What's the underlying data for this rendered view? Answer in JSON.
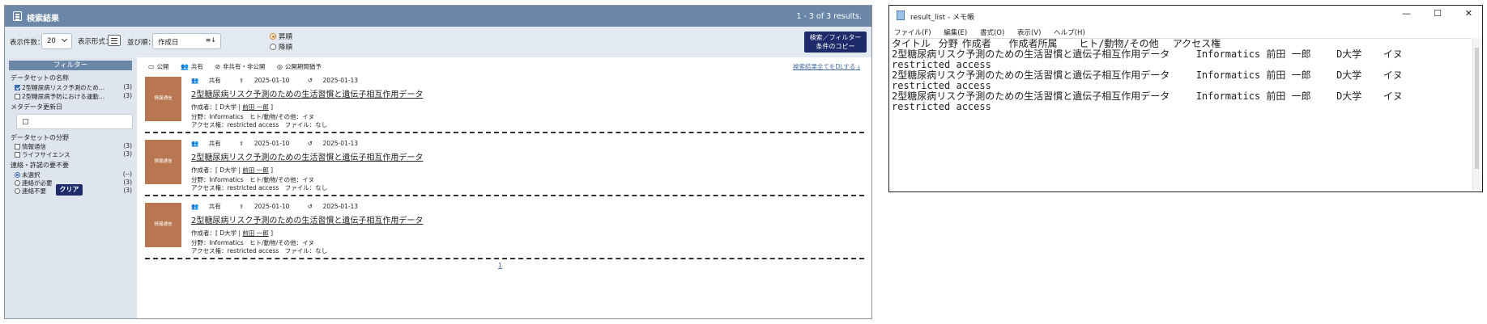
{
  "app": {
    "title": "検索結果",
    "result_count": "1 - 3 of 3 results.",
    "toolbar": {
      "per_page_label": "表示件数：",
      "per_page_value": "20",
      "display_mode_label": "表示形式：",
      "sort_label": "並び順：",
      "sort_value": "作成日",
      "asc_label": "昇順",
      "desc_label": "降順",
      "copy_button_line1": "検索／フィルター",
      "copy_button_line2": "条件のコピー"
    },
    "sidebar": {
      "filter_title": "フィルター",
      "dataset_name_label": "データセットの名称",
      "dataset_options": [
        {
          "label": "2型糖尿病リスク予測のため…",
          "count": "(3)",
          "checked": true
        },
        {
          "label": "2型糖尿病予防における運動…",
          "count": "(3)",
          "checked": false
        }
      ],
      "metadata_updated_label": "メタデータ更新日",
      "field_label": "データセットの分野",
      "field_options": [
        {
          "label": "情報通信",
          "count": "(3)"
        },
        {
          "label": "ライフサイエンス",
          "count": "(3)"
        }
      ],
      "contact_label": "連絡・許諾の要不要",
      "contact_options": [
        {
          "label": "未選択",
          "count": "(--)",
          "selected": true
        },
        {
          "label": "連絡が必要",
          "count": "(3)",
          "selected": false
        },
        {
          "label": "連絡不要",
          "count": "(3)",
          "selected": false
        }
      ],
      "clear_button": "クリア"
    },
    "tabs": [
      "公開",
      "共有",
      "非共有・非公開",
      "公開期間猶予"
    ],
    "download_link": "検索結果全てをDLする",
    "results": [
      {
        "thumb": "情報通信",
        "share": "共有",
        "created": "2025-01-10",
        "updated": "2025-01-13",
        "title": "2型糖尿病リスク予測のための生活習慣と遺伝子相互作用データ",
        "author_prefix": "作成者：[ D大学 | ",
        "author_name": "前田 一郎",
        "author_suffix": " ]",
        "field_line": "分野：Informatics　ヒト/動物/その他：イヌ",
        "access_line": "アクセス権：restricted access　ファイル：なし"
      },
      {
        "thumb": "情報通信",
        "share": "共有",
        "created": "2025-01-10",
        "updated": "2025-01-13",
        "title": "2型糖尿病リスク予測のための生活習慣と遺伝子相互作用データ",
        "author_prefix": "作成者：[ D大学 | ",
        "author_name": "前田 一郎",
        "author_suffix": " ]",
        "field_line": "分野：Informatics　ヒト/動物/その他：イヌ",
        "access_line": "アクセス権：restricted access　ファイル：なし"
      },
      {
        "thumb": "情報通信",
        "share": "共有",
        "created": "2025-01-10",
        "updated": "2025-01-13",
        "title": "2型糖尿病リスク予測のための生活習慣と遺伝子相互作用データ",
        "author_prefix": "作成者：[ D大学 | ",
        "author_name": "前田 一郎",
        "author_suffix": " ]",
        "field_line": "分野：Informatics　ヒト/動物/その他：イヌ",
        "access_line": "アクセス権：restricted access　ファイル：なし"
      }
    ],
    "page": "1"
  },
  "notepad": {
    "title": "result_list - メモ帳",
    "window_buttons": [
      "—",
      "☐",
      "✕"
    ],
    "menu": [
      "ファイル(F)",
      "編集(E)",
      "書式(O)",
      "表示(V)",
      "ヘルプ(H)"
    ],
    "lines": [
      "タイトル\t分野\t作成者\t作成者所属\tヒト/動物/その他\tアクセス権",
      "2型糖尿病リスク予測のための生活習慣と遺伝子相互作用データ\tInformatics\t前田 一郎\tD大学\tイヌ",
      "restricted access",
      "2型糖尿病リスク予測のための生活習慣と遺伝子相互作用データ\tInformatics\t前田 一郎\tD大学\tイヌ",
      "restricted access",
      "2型糖尿病リスク予測のための生活習慣と遺伝子相互作用データ\tInformatics\t前田 一郎\tD大学\tイヌ",
      "restricted access"
    ]
  }
}
